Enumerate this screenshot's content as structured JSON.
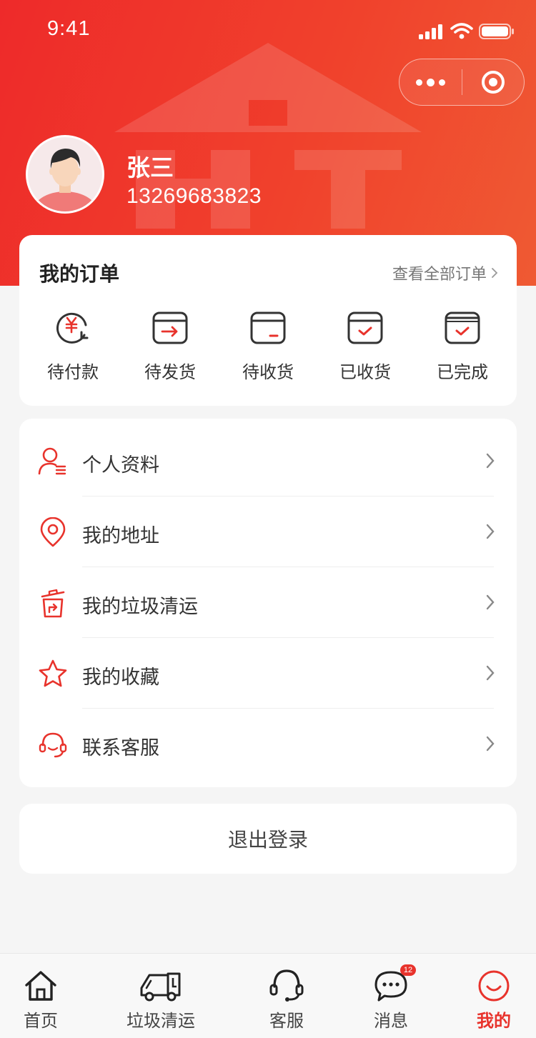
{
  "status_bar": {
    "time": "9:41"
  },
  "brand": {
    "accent": "#e8332c"
  },
  "user": {
    "name": "张三",
    "phone": "13269683823"
  },
  "orders": {
    "title": "我的订单",
    "view_all": "查看全部订单",
    "items": [
      {
        "label": "待付款",
        "icon": "payment-yuan-icon"
      },
      {
        "label": "待发货",
        "icon": "box-arrow-icon"
      },
      {
        "label": "待收货",
        "icon": "box-receive-icon"
      },
      {
        "label": "已收货",
        "icon": "box-check-icon"
      },
      {
        "label": "已完成",
        "icon": "box-done-icon"
      }
    ]
  },
  "menu": {
    "items": [
      {
        "label": "个人资料",
        "icon": "profile-icon"
      },
      {
        "label": "我的地址",
        "icon": "location-pin-icon"
      },
      {
        "label": "我的垃圾清运",
        "icon": "trash-transfer-icon"
      },
      {
        "label": "我的收藏",
        "icon": "star-icon"
      },
      {
        "label": "联系客服",
        "icon": "headset-icon"
      }
    ]
  },
  "logout": {
    "label": "退出登录"
  },
  "tabbar": {
    "items": [
      {
        "label": "首页",
        "icon": "home-icon"
      },
      {
        "label": "垃圾清运",
        "icon": "truck-icon"
      },
      {
        "label": "客服",
        "icon": "headset-icon"
      },
      {
        "label": "消息",
        "icon": "chat-icon",
        "badge": "12"
      },
      {
        "label": "我的",
        "icon": "smile-icon",
        "active": true
      }
    ]
  }
}
